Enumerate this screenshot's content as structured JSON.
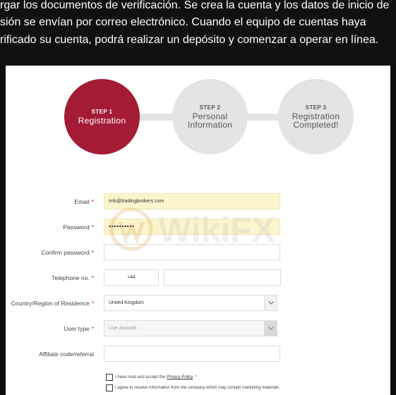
{
  "intro": {
    "line1": "rgar los documentos de verificación. Se crea la cuenta y los datos de inicio de",
    "line2": "sión se envían por correo electrónico. Cuando el equipo de cuentas haya",
    "line3": "rificado su cuenta, podrá realizar un depósito y comenzar a operar en línea."
  },
  "steps": [
    {
      "num": "STEP 1",
      "name1": "Registration",
      "name2": ""
    },
    {
      "num": "STEP 2",
      "name1": "Personal",
      "name2": "Information"
    },
    {
      "num": "STEP 3",
      "name1": "Registration",
      "name2": "Completed!"
    }
  ],
  "form": {
    "email_label": "Email",
    "email_value": "info@tradingbrokers.com",
    "password_label": "Password",
    "password_value": "••••••••••",
    "confirm_label": "Confirm password",
    "phone_label": "Telephone no.",
    "phone_code": "+44",
    "country_label": "Country/Region of Residence",
    "country_value": "United Kingdom",
    "usertype_label": "User type",
    "usertype_value": "Live account",
    "affiliate_label": "Affiliate code/referral",
    "required_mark": "*"
  },
  "consent": {
    "privacy_text": "I have read and accept the",
    "privacy_link": "Privacy Policy",
    "marketing_text": "I agree to receive information from the company which may contain marketing materials"
  },
  "watermark": {
    "text": "WikiFX"
  },
  "colors": {
    "accent": "#a31b34",
    "step_inactive": "#e4e4e4",
    "autofill": "#fbf4cd",
    "required": "#c0143c"
  }
}
